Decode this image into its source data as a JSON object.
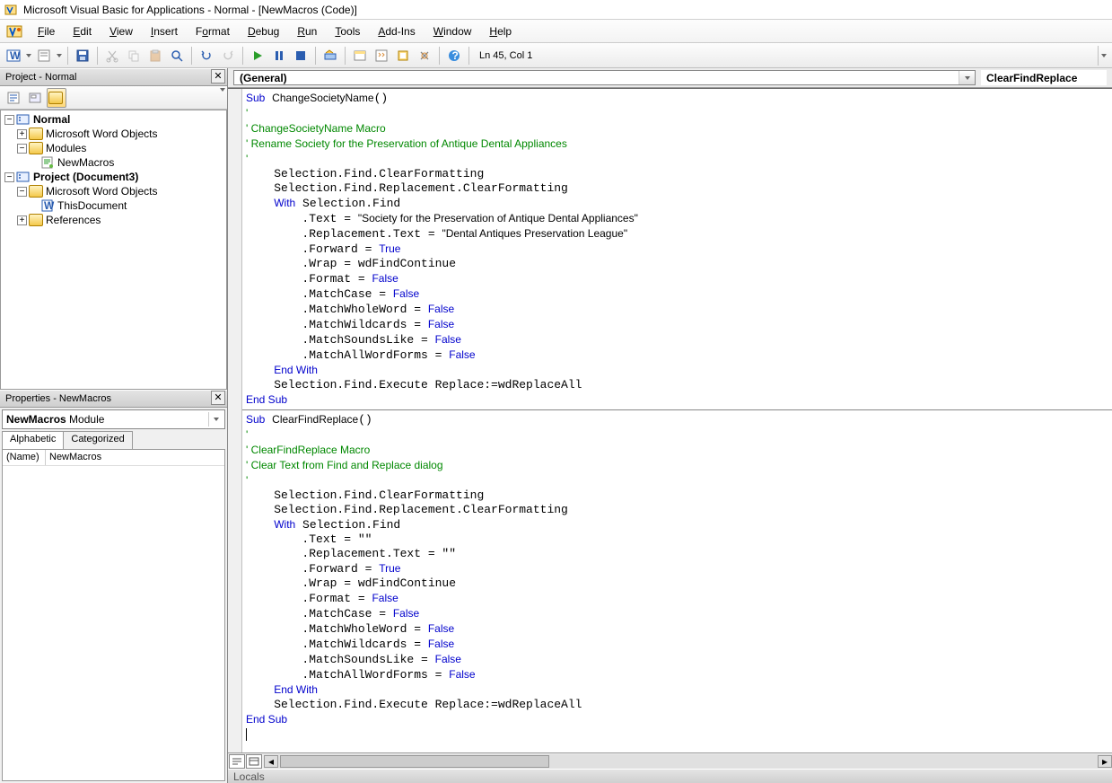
{
  "window": {
    "title": "Microsoft Visual Basic for Applications - Normal - [NewMacros (Code)]"
  },
  "menu": {
    "file": "File",
    "edit": "Edit",
    "view": "View",
    "insert": "Insert",
    "format": "Format",
    "debug": "Debug",
    "run": "Run",
    "tools": "Tools",
    "addins": "Add-Ins",
    "window": "Window",
    "help": "Help"
  },
  "toolbar": {
    "status": "Ln 45, Col 1"
  },
  "project_pane": {
    "title": "Project - Normal",
    "tree": {
      "normal": "Normal",
      "mwo1": "Microsoft Word Objects",
      "modules": "Modules",
      "newmacros": "NewMacros",
      "project": "Project (Document3)",
      "mwo2": "Microsoft Word Objects",
      "thisdoc": "ThisDocument",
      "refs": "References"
    }
  },
  "properties_pane": {
    "title": "Properties - NewMacros",
    "combo_name": "NewMacros",
    "combo_type": "Module",
    "tab_alpha": "Alphabetic",
    "tab_cat": "Categorized",
    "prop_name_label": "(Name)",
    "prop_name_value": "NewMacros"
  },
  "code_header": {
    "left": "(General)",
    "right": "ClearFindReplace"
  },
  "code": {
    "sub1_name": "ChangeSocietyName",
    "sub1_c1": " ChangeSocietyName Macro",
    "sub1_c2": " Rename Society for the Preservation of Antique Dental Appliances",
    "find_text": "\"Society for the Preservation of Antique Dental Appliances\"",
    "repl_text": "\"Dental Antiques Preservation League\"",
    "sub2_name": "ClearFindReplace",
    "sub2_c1": " ClearFindReplace Macro",
    "sub2_c2": " Clear Text from Find and Replace dialog"
  },
  "locals": {
    "title": "Locals"
  }
}
